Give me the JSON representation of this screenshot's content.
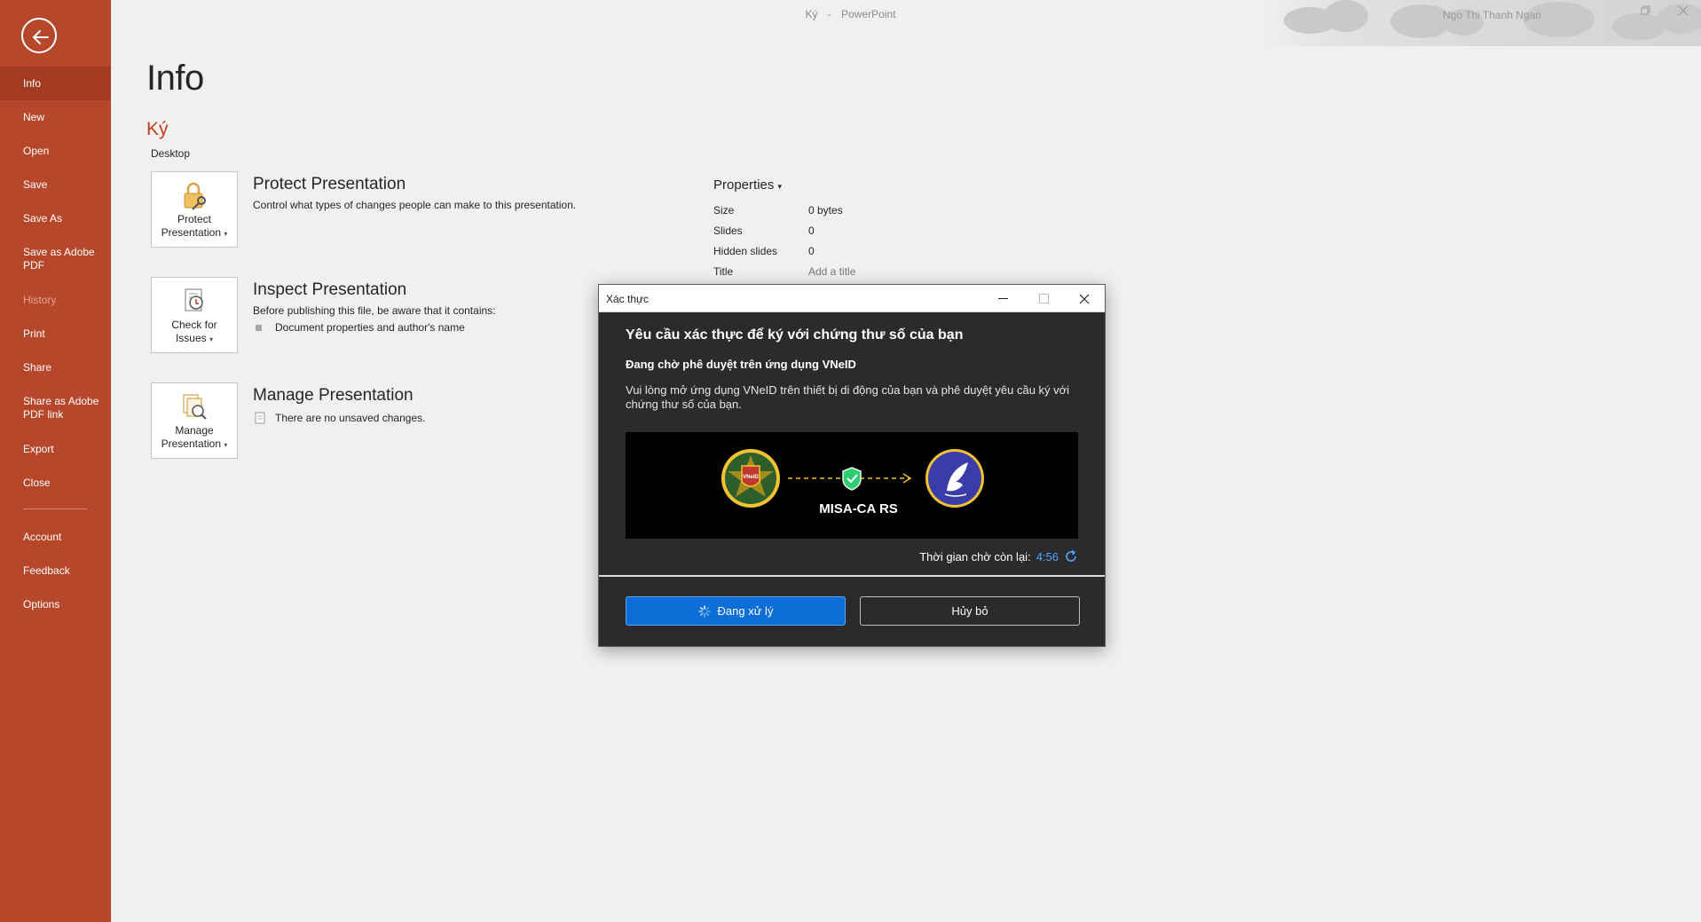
{
  "window": {
    "doc_title": "Ký",
    "separator": "-",
    "app_name": "PowerPoint",
    "user_name": "Ngo Thi Thanh Ngan"
  },
  "sidebar": {
    "back_icon": "back-arrow-icon",
    "items": [
      {
        "label": "Info",
        "state": "active"
      },
      {
        "label": "New"
      },
      {
        "label": "Open"
      },
      {
        "label": "Save"
      },
      {
        "label": "Save As"
      },
      {
        "label": "Save as Adobe PDF"
      },
      {
        "label": "History",
        "state": "disabled"
      },
      {
        "label": "Print"
      },
      {
        "label": "Share"
      },
      {
        "label": "Share as Adobe PDF link"
      },
      {
        "label": "Export"
      },
      {
        "label": "Close"
      },
      {
        "label": "Account"
      },
      {
        "label": "Feedback"
      },
      {
        "label": "Options"
      }
    ]
  },
  "info": {
    "page_title": "Info",
    "doc_name": "Ký",
    "doc_location": "Desktop",
    "sections": {
      "protect": {
        "button_line1": "Protect",
        "button_line2": "Presentation",
        "title": "Protect Presentation",
        "desc": "Control what types of changes people can make to this presentation."
      },
      "inspect": {
        "button_line1": "Check for",
        "button_line2": "Issues",
        "title": "Inspect Presentation",
        "desc": "Before publishing this file, be aware that it contains:",
        "bullet": "Document properties and author's name"
      },
      "manage": {
        "button_line1": "Manage",
        "button_line2": "Presentation",
        "title": "Manage Presentation",
        "note": "There are no unsaved changes."
      }
    },
    "properties": {
      "title": "Properties",
      "rows": [
        {
          "label": "Size",
          "value": "0 bytes"
        },
        {
          "label": "Slides",
          "value": "0"
        },
        {
          "label": "Hidden slides",
          "value": "0"
        },
        {
          "label": "Title",
          "value": "Add a title"
        }
      ]
    }
  },
  "dialog": {
    "title": "Xác thực",
    "heading": "Yêu cầu xác thực để ký với chứng thư số của bạn",
    "subheading": "Đang chờ phê duyệt trên ứng dụng VNeID",
    "message": "Vui lòng mở ứng dụng VNeID trên thiết bị di động của bạn và phê duyệt yêu cầu ký với chứng thư số của bạn.",
    "banner_label": "MISA-CA RS",
    "badge_text": "VNeID",
    "timer_label": "Thời gian chờ còn lại:",
    "timer_value": "4:56",
    "primary_button": "Đang xử lý",
    "secondary_button": "Hủy bỏ",
    "accent_color": "#0c6ed6"
  }
}
